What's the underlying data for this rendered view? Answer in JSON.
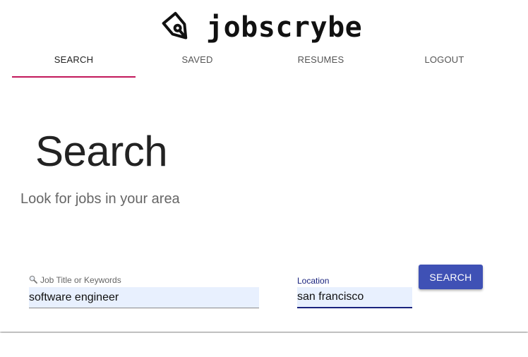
{
  "brand": {
    "name": "jobscrybe",
    "icon": "pen-nib-icon"
  },
  "nav": {
    "tabs": [
      {
        "label": "SEARCH",
        "active": true
      },
      {
        "label": "SAVED",
        "active": false
      },
      {
        "label": "RESUMES",
        "active": false
      },
      {
        "label": "LOGOUT",
        "active": false
      }
    ]
  },
  "main": {
    "title": "Search",
    "subtitle": "Look for jobs in your area"
  },
  "search_form": {
    "keywords": {
      "label": "Job Title or Keywords",
      "icon": "search-icon",
      "value": "software engineer"
    },
    "location": {
      "label": "Location",
      "value": "san francisco"
    },
    "submit_label": "SEARCH"
  },
  "colors": {
    "active_tab_underline": "#c2185b",
    "primary_button": "#3f51b5",
    "input_fill": "#e8f0fe",
    "focused_underline": "#1a237e"
  }
}
